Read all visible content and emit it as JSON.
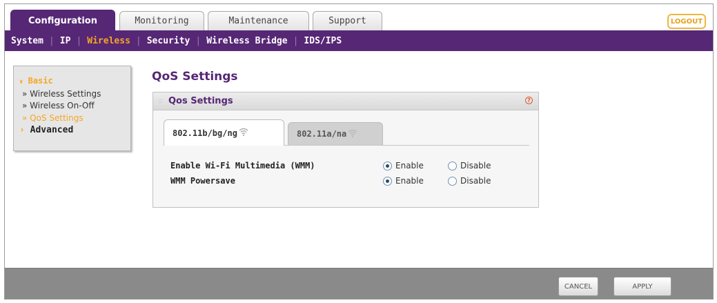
{
  "top_tabs": [
    {
      "label": "Configuration",
      "active": true
    },
    {
      "label": "Monitoring",
      "active": false
    },
    {
      "label": "Maintenance",
      "active": false
    },
    {
      "label": "Support",
      "active": false
    }
  ],
  "logout_label": "LOGOUT",
  "subnav": [
    {
      "label": "System",
      "active": false
    },
    {
      "label": "IP",
      "active": false
    },
    {
      "label": "Wireless",
      "active": true
    },
    {
      "label": "Security",
      "active": false
    },
    {
      "label": "Wireless Bridge",
      "active": false
    },
    {
      "label": "IDS/IPS",
      "active": false
    }
  ],
  "left_menu": {
    "basic_label": "Basic",
    "items": [
      {
        "label": "» Wireless Settings"
      },
      {
        "label": "» Wireless On-Off"
      },
      {
        "label": "» QoS Settings",
        "active": true
      }
    ],
    "advanced_label": "Advanced"
  },
  "page_title": "QoS Settings",
  "panel": {
    "title": "Qos Settings",
    "help_glyph": "?",
    "tabs": [
      {
        "label": "802.11b/bg/ng",
        "active": true
      },
      {
        "label": "802.11a/na",
        "active": false
      }
    ],
    "rows": [
      {
        "label": "Enable Wi-Fi Multimedia (WMM)",
        "enable": "Enable",
        "disable": "Disable",
        "selected": "Enable"
      },
      {
        "label": "WMM Powersave",
        "enable": "Enable",
        "disable": "Disable",
        "selected": "Enable"
      }
    ]
  },
  "buttons": {
    "cancel": "CANCEL",
    "apply": "APPLY"
  },
  "colors": {
    "brand_purple": "#562775",
    "accent_orange": "#f5a623"
  }
}
